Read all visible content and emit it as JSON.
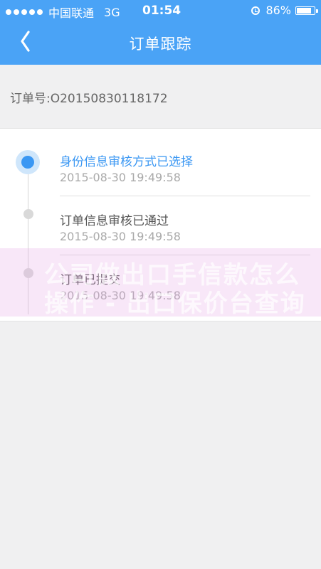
{
  "status_bar": {
    "carrier": "中国联通",
    "network": "3G",
    "time": "01:54",
    "battery": "86%",
    "battery_level": 0.86,
    "icons": [
      "signal-dots-icon",
      "alarm-icon",
      "battery-icon"
    ]
  },
  "nav": {
    "title": "订单跟踪",
    "back_icon": "chevron-left-icon"
  },
  "order": {
    "label": "订单号:",
    "number": "O20150830118172"
  },
  "timeline": [
    {
      "title": "身份信息审核方式已选择",
      "time": "2015-08-30 19:49:58",
      "active": true
    },
    {
      "title": "订单信息审核已通过",
      "time": "2015-08-30 19:49:58",
      "active": false
    },
    {
      "title": "订单已提交",
      "time": "2015-08-30 19:49:58",
      "active": false
    }
  ],
  "watermark": {
    "line1": "公司做出口手信款怎么",
    "line2": "操作 - 出口保价台查询"
  },
  "colors": {
    "primary": "#4aa3f6",
    "active_step": "#3a97f3",
    "background": "#f0f0f1"
  }
}
